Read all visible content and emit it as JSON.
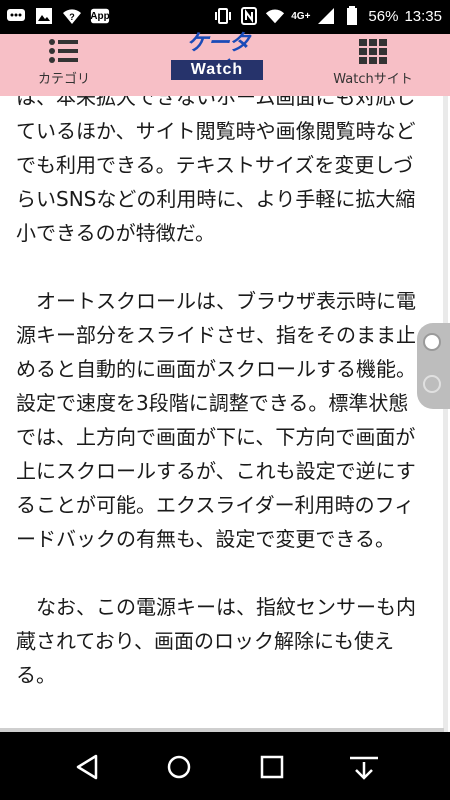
{
  "status_bar": {
    "battery_percent": "56%",
    "time": "13:35",
    "network": "4G+",
    "left_icons": [
      "chat-icon",
      "image-icon",
      "wifi-question-icon",
      "app-icon"
    ],
    "app_icon_text": "App"
  },
  "header": {
    "left_label": "カテゴリ",
    "right_label": "Watchサイト",
    "logo_top": "ケータイ",
    "logo_bottom": "Watch",
    "background": "#f7bfc6"
  },
  "article": {
    "paragraphs": [
      "は、本来拡大できないホーム画面にも対応しているほか、サイト閲覧時や画像閲覧時などでも利用できる。テキストサイズを変更しづらいSNSなどの利用時に、より手軽に拡大縮小できるのが特徴だ。",
      "　オートスクロールは、ブラウザ表示時に電源キー部分をスライドさせ、指をそのまま止めると自動的に画面がスクロールする機能。設定で速度を3段階に調整できる。標準状態では、上方向で画面が下に、下方向で画面が上にスクロールするが、これも設定で逆にすることが可能。エクスライダー利用時のフィードバックの有無も、設定で変更できる。",
      "　なお、この電源キーは、指紋センサーも内蔵されており、画面のロック解除にも使える。"
    ]
  },
  "navbar": {
    "buttons": [
      "back-icon",
      "home-icon",
      "recents-icon",
      "dropdown-icon"
    ]
  }
}
